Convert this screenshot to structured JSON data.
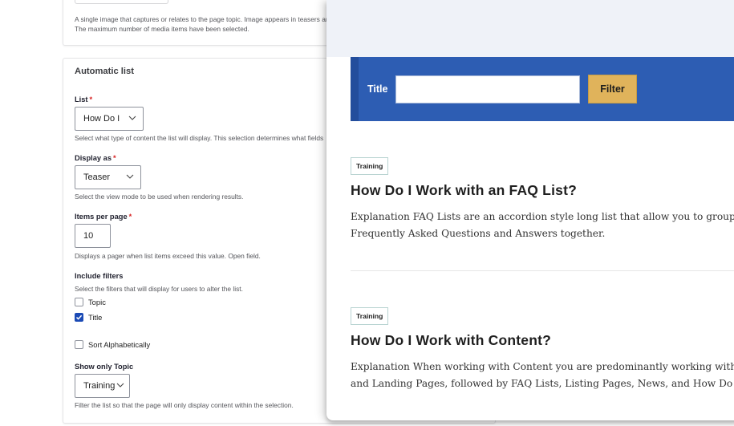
{
  "media_field": {
    "description_line1": "A single image that captures or relates to the page topic. Image appears in teasers and",
    "description_line2": "The maximum number of media items have been selected."
  },
  "automatic_list": {
    "section_title": "Automatic list",
    "list": {
      "label": "List",
      "required_marker": "*",
      "value": "How Do I",
      "description": "Select what type of content the list will display. This selection determines what fields"
    },
    "display_as": {
      "label": "Display as",
      "required_marker": "*",
      "value": "Teaser",
      "description": "Select the view mode to be used when rendering results."
    },
    "items_per_page": {
      "label": "Items per page",
      "required_marker": "*",
      "value": "10",
      "description": "Displays a pager when list items exceed this value. Open field."
    },
    "include_filters": {
      "label": "Include filters",
      "description": "Select the filters that will display for users to alter the list.",
      "options": [
        {
          "label": "Topic",
          "checked": false
        },
        {
          "label": "Title",
          "checked": true
        }
      ]
    },
    "sort_alphabetically": {
      "label": "Sort Alphabetically",
      "checked": false
    },
    "show_only_topic": {
      "label": "Show only Topic",
      "value": "Training",
      "description": "Filter the list so that the page will only display content within the selection."
    }
  },
  "preview": {
    "filter": {
      "label": "Title",
      "input_value": "",
      "button_label": "Filter"
    },
    "results": [
      {
        "badge": "Training",
        "title": "How Do I Work with an FAQ List?",
        "body_line1": "Explanation FAQ Lists are an accordion style long list that allow you to group common",
        "body_line2": "Frequently Asked Questions and Answers together."
      },
      {
        "badge": "Training",
        "title": "How Do I Work with Content?",
        "body_line1": "Explanation When working with Content you are predominantly working with Basic Pages",
        "body_line2": "and Landing Pages, followed by FAQ Lists, Listing Pages, News, and How Do I"
      }
    ]
  },
  "colors": {
    "accent_blue": "#2d5db3",
    "filter_button": "#e0b35b",
    "required_red": "#d72222",
    "checkbox_checked": "#1b4ab5"
  }
}
